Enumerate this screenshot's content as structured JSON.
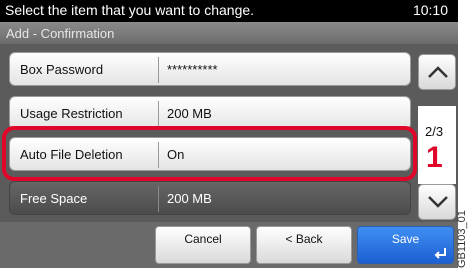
{
  "header": {
    "message": "Select the item that you want to change.",
    "time": "10:10"
  },
  "subtitle": "Add - Confirmation",
  "rows": [
    {
      "label": "Box Password",
      "value": "**********"
    },
    {
      "label": "Usage Restriction",
      "value": "200 MB"
    },
    {
      "label": "Auto File Deletion",
      "value": "On"
    },
    {
      "label": "Free Space",
      "value": "200 MB"
    }
  ],
  "pager": {
    "indicator": "2/3"
  },
  "callout": {
    "number": "1",
    "color": "#e0062a"
  },
  "buttons": {
    "cancel": "Cancel",
    "back": "< Back",
    "save": "Save"
  },
  "image_tag": "GB1103_01"
}
